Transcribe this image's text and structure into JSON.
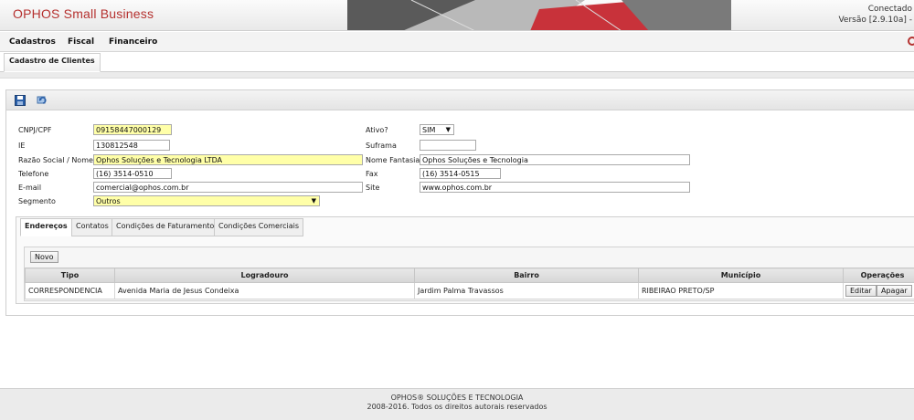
{
  "header": {
    "brand": "OPHOS Small Business",
    "connection_status": "Conectado",
    "version": "Versão [2.9.10a] -"
  },
  "menu": {
    "items": [
      "Cadastros",
      "Fiscal",
      "Financeiro"
    ]
  },
  "page_tab": "Cadastro de Clientes",
  "toolbar": {
    "icons": [
      "save-icon",
      "refresh-icon"
    ]
  },
  "form": {
    "cnpj_label": "CNPJ/CPF",
    "cnpj_value": "09158447000129",
    "ie_label": "IE",
    "ie_value": "130812548",
    "razao_label": "Razão Social / Nome",
    "razao_value": "Ophos Soluções e Tecnologia LTDA",
    "telefone_label": "Telefone",
    "telefone_value": "(16) 3514-0510",
    "email_label": "E-mail",
    "email_value": "comercial@ophos.com.br",
    "segmento_label": "Segmento",
    "segmento_value": "Outros",
    "ativo_label": "Ativo?",
    "ativo_value": "SIM",
    "suframa_label": "Suframa",
    "suframa_value": "",
    "fantasia_label": "Nome Fantasia",
    "fantasia_value": "Ophos Soluções e Tecnologia",
    "fax_label": "Fax",
    "fax_value": "(16) 3514-0515",
    "site_label": "Site",
    "site_value": "www.ophos.com.br",
    "required_color": "#ffffa8"
  },
  "tabs": [
    "Endereços",
    "Contatos",
    "Condições de Faturamento",
    "Condições Comerciais"
  ],
  "grid": {
    "new_button": "Novo",
    "columns": [
      "Tipo",
      "Logradouro",
      "Bairro",
      "Município",
      "Operações"
    ],
    "rows": [
      {
        "tipo": "CORRESPONDENCIA",
        "logradouro": "Avenida Maria de Jesus Condeixa",
        "bairro": "Jardim Palma Travassos",
        "municipio": "RIBEIRAO PRETO/SP",
        "edit": "Editar",
        "delete": "Apagar"
      }
    ]
  },
  "footer": {
    "line1": "OPHOS® SOLUÇÕES E TECNOLOGIA",
    "line2": "2008-2016. Todos os direitos autorais reservados"
  },
  "colors": {
    "brand": "#b5312f",
    "accent_dark": "#444444"
  }
}
